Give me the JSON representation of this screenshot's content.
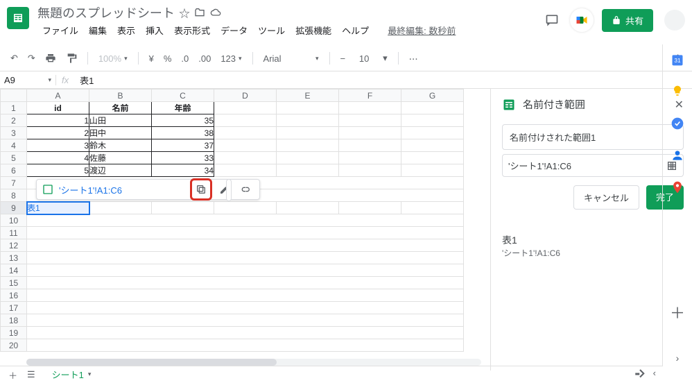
{
  "header": {
    "title": "無題のスプレッドシート",
    "menus": [
      "ファイル",
      "編集",
      "表示",
      "挿入",
      "表示形式",
      "データ",
      "ツール",
      "拡張機能",
      "ヘルプ"
    ],
    "last_edit": "最終編集: 数秒前",
    "share": "共有"
  },
  "toolbar": {
    "zoom": "100%",
    "currency": "¥",
    "percent": "%",
    "dec_dec": ".0",
    "dec_inc": ".00",
    "numfmt": "123",
    "font": "Arial",
    "size": "10"
  },
  "formula": {
    "cell": "A9",
    "value": "表1"
  },
  "columns": [
    "A",
    "B",
    "C",
    "D",
    "E",
    "F",
    "G"
  ],
  "rows": [
    "1",
    "2",
    "3",
    "4",
    "5",
    "6",
    "7",
    "8",
    "9",
    "10",
    "11",
    "12",
    "13",
    "14",
    "15",
    "16",
    "17",
    "18",
    "19",
    "20"
  ],
  "data": {
    "headers": [
      "id",
      "名前",
      "年齢"
    ],
    "rows": [
      [
        "1",
        "山田",
        "35"
      ],
      [
        "2",
        "田中",
        "38"
      ],
      [
        "3",
        "鈴木",
        "37"
      ],
      [
        "4",
        "佐藤",
        "33"
      ],
      [
        "5",
        "渡辺",
        "34"
      ]
    ]
  },
  "editing_cell": "表1",
  "chip": {
    "range": "'シート1'!A1:C6"
  },
  "sidebar": {
    "title": "名前付き範囲",
    "name_input": "名前付けされた範囲1",
    "range_input": "'シート1'!A1:C6",
    "cancel": "キャンセル",
    "done": "完了",
    "list": {
      "name": "表1",
      "range": "'シート1'!A1:C6"
    }
  },
  "bottom": {
    "tab": "シート1"
  }
}
